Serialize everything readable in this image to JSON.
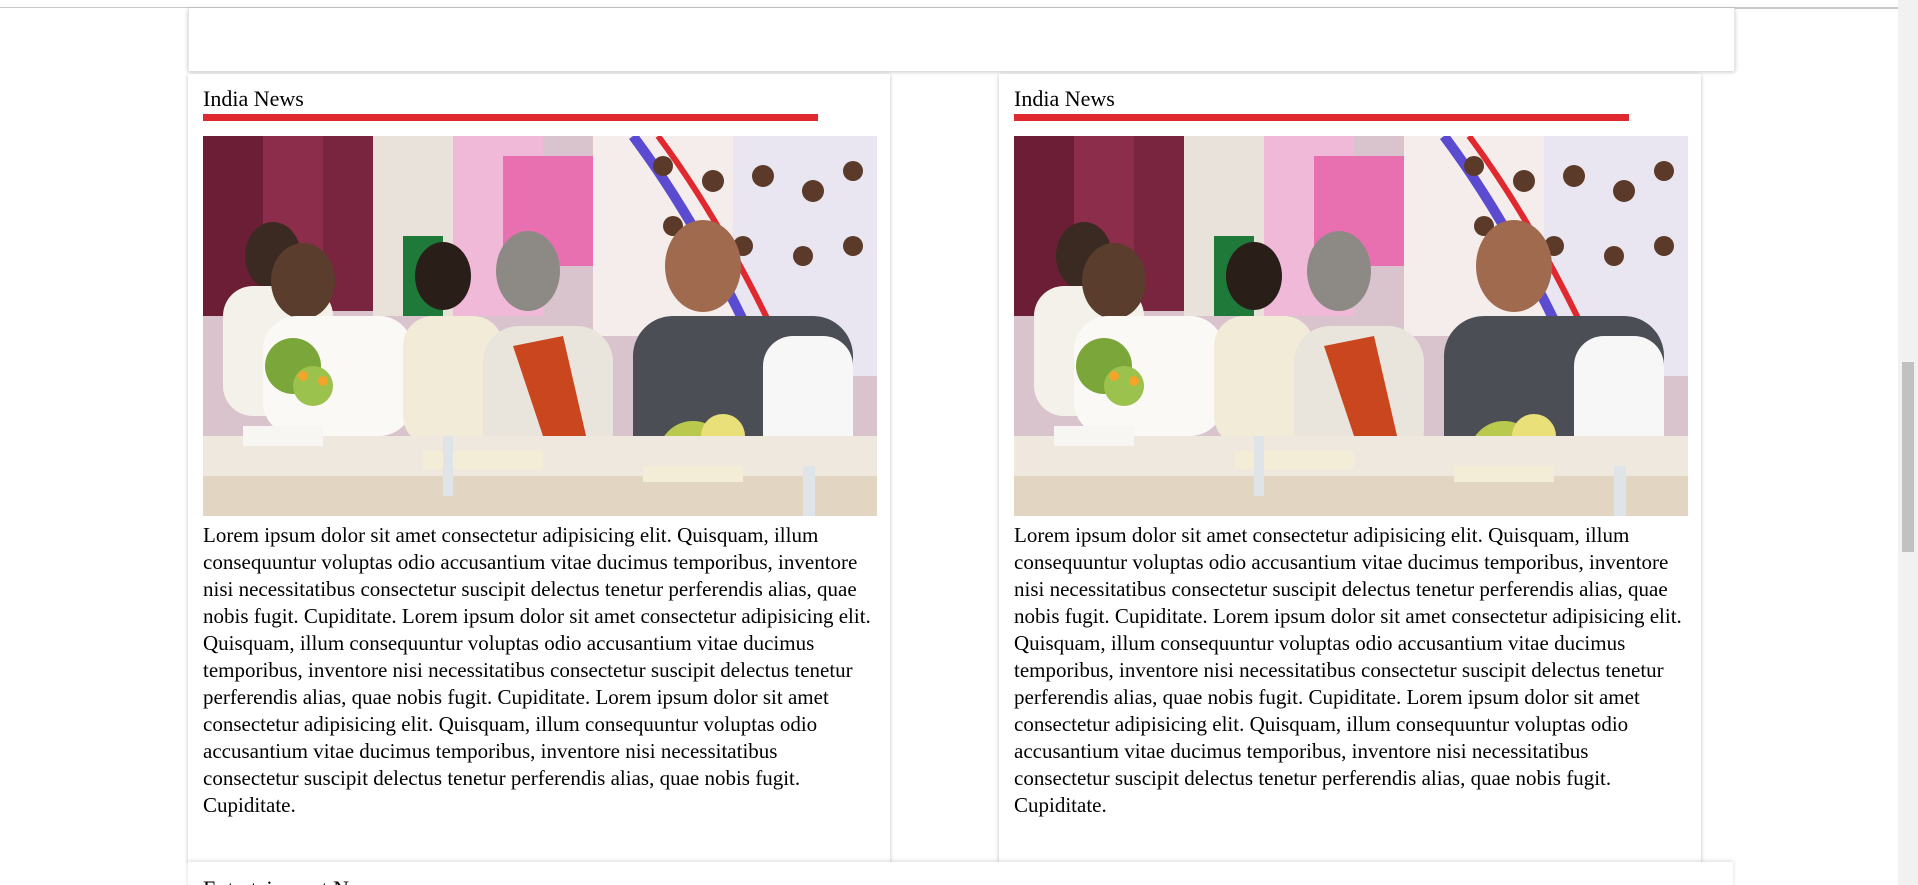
{
  "articles": [
    {
      "heading": "India News",
      "image_alt": "Leaders seated at a conference table with microphones and flowers",
      "body": "Lorem ipsum dolor sit amet consectetur adipisicing elit. Quisquam, illum consequuntur voluptas odio accusantium vitae ducimus temporibus, inventore nisi necessitatibus consectetur suscipit delectus tenetur perferendis alias, quae nobis fugit. Cupiditate. Lorem ipsum dolor sit amet consectetur adipisicing elit. Quisquam, illum consequuntur voluptas odio accusantium vitae ducimus temporibus, inventore nisi necessitatibus consectetur suscipit delectus tenetur perferendis alias, quae nobis fugit. Cupiditate. Lorem ipsum dolor sit amet consectetur adipisicing elit. Quisquam, illum consequuntur voluptas odio accusantium vitae ducimus temporibus, inventore nisi necessitatibus consectetur suscipit delectus tenetur perferendis alias, quae nobis fugit. Cupiditate."
    },
    {
      "heading": "India News",
      "image_alt": "Leaders seated at a conference table with microphones and flowers",
      "body": "Lorem ipsum dolor sit amet consectetur adipisicing elit. Quisquam, illum consequuntur voluptas odio accusantium vitae ducimus temporibus, inventore nisi necessitatibus consectetur suscipit delectus tenetur perferendis alias, quae nobis fugit. Cupiditate. Lorem ipsum dolor sit amet consectetur adipisicing elit. Quisquam, illum consequuntur voluptas odio accusantium vitae ducimus temporibus, inventore nisi necessitatibus consectetur suscipit delectus tenetur perferendis alias, quae nobis fugit. Cupiditate. Lorem ipsum dolor sit amet consectetur adipisicing elit. Quisquam, illum consequuntur voluptas odio accusantium vitae ducimus temporibus, inventore nisi necessitatibus consectetur suscipit delectus tenetur perferendis alias, quae nobis fugit. Cupiditate."
    }
  ],
  "next_section": {
    "heading": "Entertainment News"
  },
  "colors": {
    "accent": "#e0292e",
    "card_bg": "#ffffff",
    "scroll_track": "#f1f1f1",
    "scroll_thumb": "#c1c1c1"
  }
}
